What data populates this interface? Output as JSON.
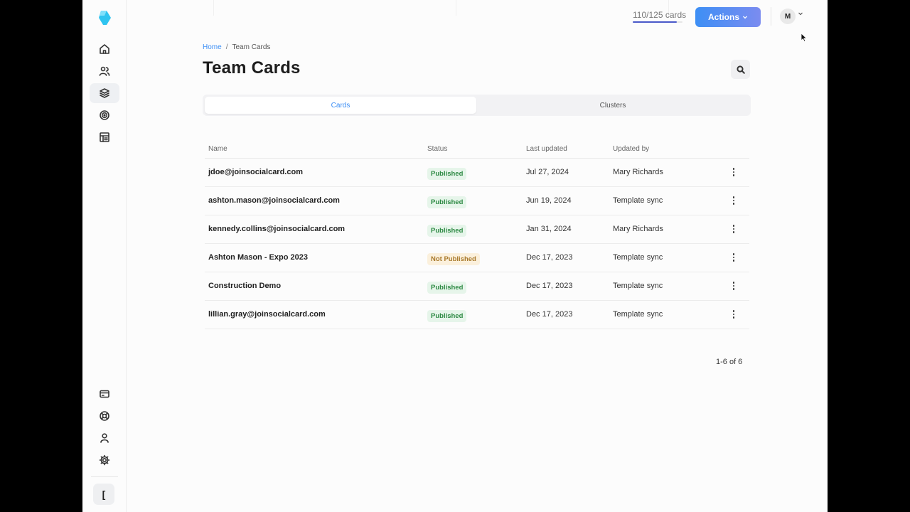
{
  "usage": {
    "text": "110/125 cards",
    "fraction": 0.88
  },
  "actions_label": "Actions",
  "avatar_initial": "M",
  "breadcrumb": {
    "home": "Home",
    "separator": "/",
    "current": "Team Cards"
  },
  "page_title": "Team Cards",
  "tabs": [
    {
      "label": "Cards",
      "active": true
    },
    {
      "label": "Clusters",
      "active": false
    }
  ],
  "table": {
    "headers": {
      "name": "Name",
      "status": "Status",
      "updated": "Last updated",
      "by": "Updated by"
    },
    "rows": [
      {
        "name": "jdoe@joinsocialcard.com",
        "status": "Published",
        "updated": "Jul 27, 2024",
        "by": "Mary Richards"
      },
      {
        "name": "ashton.mason@joinsocialcard.com",
        "status": "Published",
        "updated": "Jun 19, 2024",
        "by": "Template sync"
      },
      {
        "name": "kennedy.collins@joinsocialcard.com",
        "status": "Published",
        "updated": "Jan 31, 2024",
        "by": "Mary Richards"
      },
      {
        "name": "Ashton Mason - Expo 2023",
        "status": "Not Published",
        "updated": "Dec 17, 2023",
        "by": "Template sync"
      },
      {
        "name": "Construction Demo",
        "status": "Published",
        "updated": "Dec 17, 2023",
        "by": "Template sync"
      },
      {
        "name": "lillian.gray@joinsocialcard.com",
        "status": "Published",
        "updated": "Dec 17, 2023",
        "by": "Template sync"
      }
    ]
  },
  "pagination": "1-6 of 6",
  "sidebar": {
    "collapse_label": "[",
    "top_items": [
      "home-icon",
      "users-icon",
      "layers-icon",
      "target-icon",
      "layout-icon"
    ],
    "bottom_items": [
      "card-icon",
      "lifebuoy-icon",
      "user-icon",
      "gear-icon"
    ]
  },
  "colors": {
    "accent": "#3d8ff5",
    "published": "#2e8a44",
    "not_published": "#a97a2c"
  }
}
